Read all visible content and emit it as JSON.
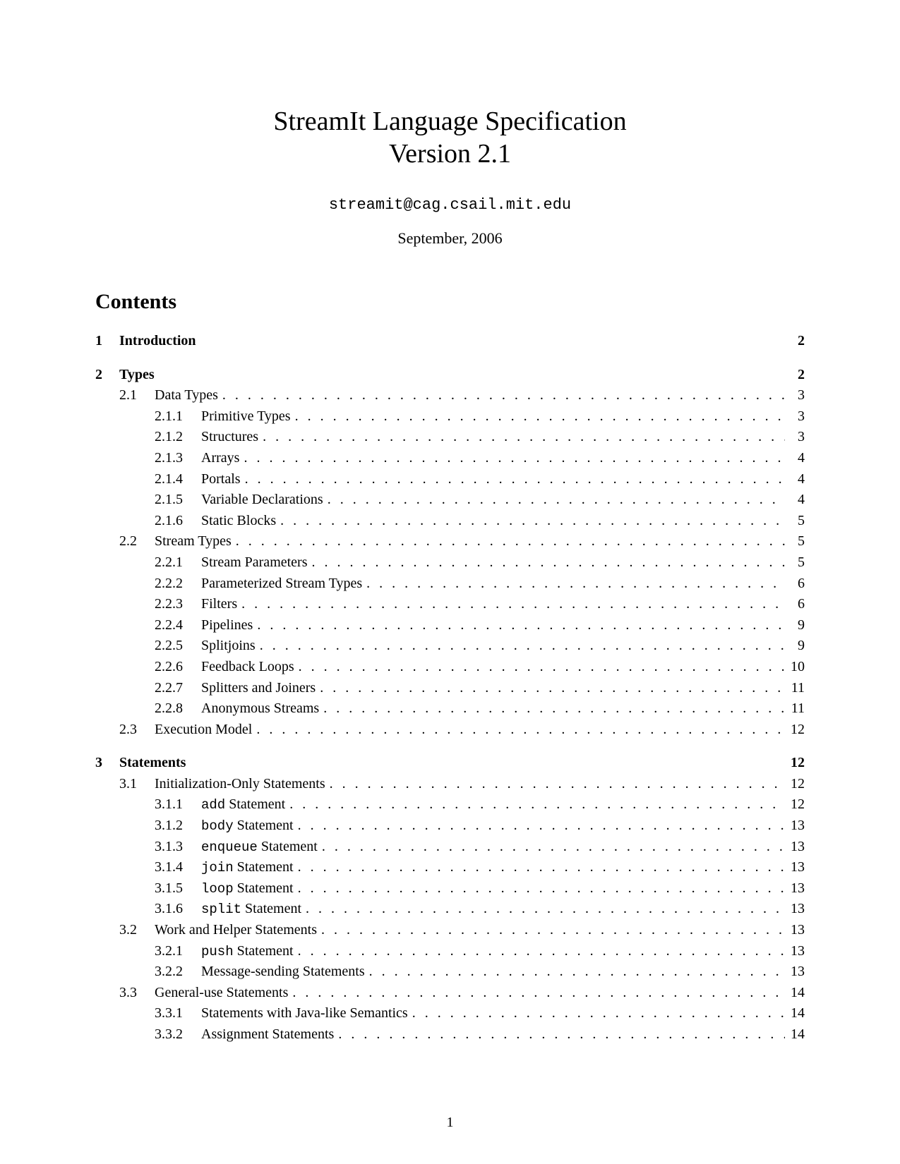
{
  "title": "StreamIt Language Specification",
  "version": "Version 2.1",
  "email": "streamit@cag.csail.mit.edu",
  "date": "September, 2006",
  "contents_heading": "Contents",
  "page_number": "1",
  "toc": [
    {
      "level": 1,
      "num": "1",
      "title": "Introduction",
      "page": "2",
      "bold": true
    },
    {
      "level": 1,
      "num": "2",
      "title": "Types",
      "page": "2",
      "bold": true
    },
    {
      "level": 2,
      "num": "2.1",
      "title": "Data Types",
      "page": "3"
    },
    {
      "level": 3,
      "num": "2.1.1",
      "title": "Primitive Types",
      "page": "3"
    },
    {
      "level": 3,
      "num": "2.1.2",
      "title": "Structures",
      "page": "3"
    },
    {
      "level": 3,
      "num": "2.1.3",
      "title": "Arrays",
      "page": "4"
    },
    {
      "level": 3,
      "num": "2.1.4",
      "title": "Portals",
      "page": "4"
    },
    {
      "level": 3,
      "num": "2.1.5",
      "title": "Variable Declarations",
      "page": "4"
    },
    {
      "level": 3,
      "num": "2.1.6",
      "title": "Static Blocks",
      "page": "5"
    },
    {
      "level": 2,
      "num": "2.2",
      "title": "Stream Types",
      "page": "5"
    },
    {
      "level": 3,
      "num": "2.2.1",
      "title": "Stream Parameters",
      "page": "5"
    },
    {
      "level": 3,
      "num": "2.2.2",
      "title": "Parameterized Stream Types",
      "page": "6"
    },
    {
      "level": 3,
      "num": "2.2.3",
      "title": "Filters",
      "page": "6"
    },
    {
      "level": 3,
      "num": "2.2.4",
      "title": "Pipelines",
      "page": "9"
    },
    {
      "level": 3,
      "num": "2.2.5",
      "title": "Splitjoins",
      "page": "9"
    },
    {
      "level": 3,
      "num": "2.2.6",
      "title": "Feedback Loops",
      "page": "10"
    },
    {
      "level": 3,
      "num": "2.2.7",
      "title": "Splitters and Joiners",
      "page": "11"
    },
    {
      "level": 3,
      "num": "2.2.8",
      "title": "Anonymous Streams",
      "page": "11"
    },
    {
      "level": 2,
      "num": "2.3",
      "title": "Execution Model",
      "page": "12"
    },
    {
      "level": 1,
      "num": "3",
      "title": "Statements",
      "page": "12",
      "bold": true
    },
    {
      "level": 2,
      "num": "3.1",
      "title": "Initialization-Only Statements",
      "page": "12"
    },
    {
      "level": 3,
      "num": "3.1.1",
      "title_pre_mono": "add",
      "title_post": " Statement",
      "page": "12"
    },
    {
      "level": 3,
      "num": "3.1.2",
      "title_pre_mono": "body",
      "title_post": " Statement",
      "page": "13"
    },
    {
      "level": 3,
      "num": "3.1.3",
      "title_pre_mono": "enqueue",
      "title_post": " Statement",
      "page": "13"
    },
    {
      "level": 3,
      "num": "3.1.4",
      "title_pre_mono": "join",
      "title_post": " Statement",
      "page": "13"
    },
    {
      "level": 3,
      "num": "3.1.5",
      "title_pre_mono": "loop",
      "title_post": " Statement",
      "page": "13"
    },
    {
      "level": 3,
      "num": "3.1.6",
      "title_pre_mono": "split",
      "title_post": " Statement",
      "page": "13"
    },
    {
      "level": 2,
      "num": "3.2",
      "title": "Work and Helper Statements",
      "page": "13"
    },
    {
      "level": 3,
      "num": "3.2.1",
      "title_pre_mono": "push",
      "title_post": " Statement",
      "page": "13"
    },
    {
      "level": 3,
      "num": "3.2.2",
      "title": "Message-sending Statements",
      "page": "13"
    },
    {
      "level": 2,
      "num": "3.3",
      "title": "General-use Statements",
      "page": "14"
    },
    {
      "level": 3,
      "num": "3.3.1",
      "title": "Statements with Java-like Semantics",
      "page": "14"
    },
    {
      "level": 3,
      "num": "3.3.2",
      "title": "Assignment Statements",
      "page": "14"
    }
  ]
}
